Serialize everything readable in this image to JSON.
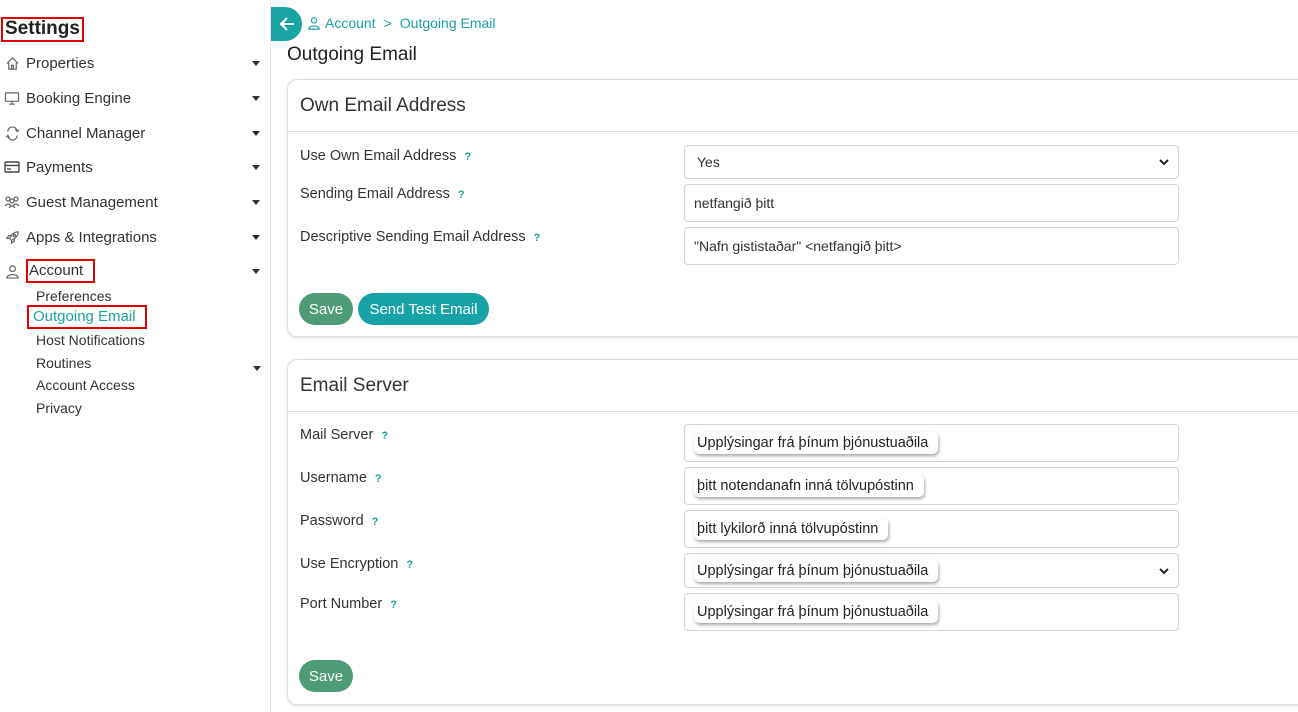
{
  "sidebar": {
    "title": "Settings",
    "items": [
      {
        "label": "Properties"
      },
      {
        "label": "Booking Engine"
      },
      {
        "label": "Channel Manager"
      },
      {
        "label": "Payments"
      },
      {
        "label": "Guest Management"
      },
      {
        "label": "Apps & Integrations"
      },
      {
        "label": "Account"
      }
    ],
    "account_sub": [
      {
        "label": "Preferences"
      },
      {
        "label": "Outgoing Email"
      },
      {
        "label": "Host Notifications"
      },
      {
        "label": "Routines"
      },
      {
        "label": "Account Access"
      },
      {
        "label": "Privacy"
      }
    ]
  },
  "breadcrumb": {
    "root": "Account",
    "sep": ">",
    "current": "Outgoing Email"
  },
  "page_title": "Outgoing Email",
  "own_email": {
    "header": "Own Email Address",
    "help": "?",
    "use_own_label": "Use Own Email Address",
    "use_own_value": "Yes",
    "sending_label": "Sending Email Address",
    "sending_value": "netfangið þitt",
    "descriptive_label": "Descriptive Sending Email Address",
    "descriptive_value": "\"Nafn gististaðar\" <netfangið þitt>",
    "save_label": "Save",
    "test_label": "Send Test Email"
  },
  "email_server": {
    "header": "Email Server",
    "help": "?",
    "mail_server_label": "Mail Server",
    "mail_server_value": "Upplýsingar frá þínum þjónustuaðila",
    "username_label": "Username",
    "username_value": "þitt notendanafn inná tölvupóstinn",
    "password_label": "Password",
    "password_value": "þitt lykilorð inná tölvupóstinn",
    "encryption_label": "Use Encryption",
    "encryption_value": "Upplýsingar frá þínum þjónustuaðila",
    "port_label": "Port Number",
    "port_value": "Upplýsingar frá þínum þjónustuaðila",
    "save_label": "Save"
  },
  "colors": {
    "accent": "#1aa3a3",
    "save": "#4f9a77",
    "highlight": "#e00000"
  }
}
